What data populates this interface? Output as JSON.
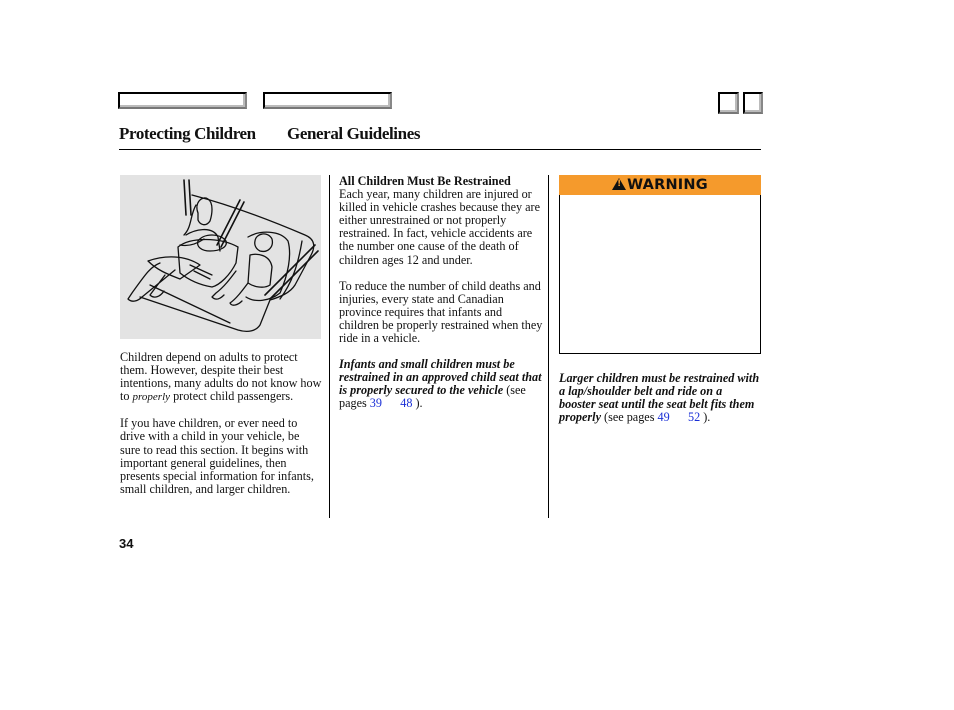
{
  "nav": {
    "buttons": [
      "prev-page",
      "next-page",
      "section-a",
      "section-b"
    ]
  },
  "header": {
    "section_title": "Protecting Children",
    "subsection_title": "General Guidelines"
  },
  "col1": {
    "illustration_alt": "Adult with infant in rear-facing child seat and child in forward-facing child seat on rear seat",
    "para1_before": "Children depend on adults to protect them. However, despite their best intentions, many adults do not know how to ",
    "para1_italic": "properly",
    "para1_after": " protect child passengers.",
    "para2": "If you have children, or ever need to drive with a child in your vehicle, be sure to read this section. It begins with important general guidelines, then presents special information for infants, small children, and larger children."
  },
  "col2": {
    "heading": "All Children Must Be Restrained",
    "para1": "Each year, many children are injured or killed in vehicle crashes because they are either unrestrained or not properly restrained. In fact, vehicle accidents are the number one cause of the death of children ages 12 and under.",
    "para2": "To reduce the number of child deaths and injuries, every state and Canadian province requires that infants and children be properly restrained when they ride in a vehicle.",
    "note_bold_italic": "Infants and small children must be restrained in an approved child seat that is properly secured to the vehicle",
    "note_see": " (see pages ",
    "link_from": "39",
    "link_to": "48",
    "note_end": " )."
  },
  "col3": {
    "warning_label": "WARNING",
    "note_bold_italic": "Larger children must be restrained with a lap/shoulder belt and ride on a booster seat until the seat belt fits them properly",
    "note_see": " (see pages ",
    "link_from": "49",
    "link_to": "52",
    "note_end": " )."
  },
  "footer": {
    "page_number": "34"
  },
  "colors": {
    "warning_orange": "#f59a2c",
    "link_blue": "#1a2fd6",
    "illustration_bg": "#e3e3e3"
  }
}
